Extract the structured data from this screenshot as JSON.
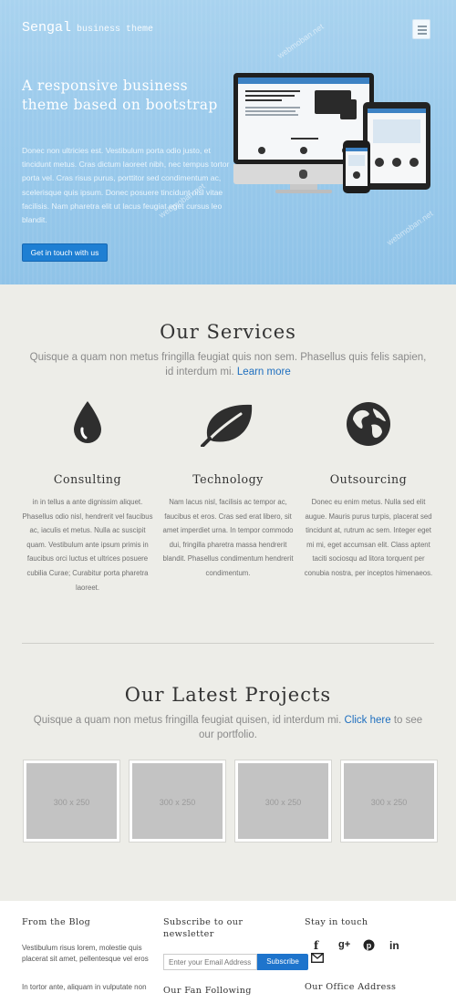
{
  "header": {
    "brand": "Sengal",
    "brand_tag": "business theme",
    "menu_icon": "hamburger-icon"
  },
  "hero": {
    "title": "A responsive business theme based on bootstrap",
    "text": "Donec non ultricies est. Vestibulum porta odio justo, et tincidunt metus. Cras dictum laoreet nibh, nec tempus tortor porta vel. Cras risus purus, porttitor sed condimentum ac, scelerisque quis ipsum. Donec posuere tincidunt nisl vitae facilisis. Nam pharetra elit ut lacus feugiat eget cursus leo blandit.",
    "cta": "Get in touch with us"
  },
  "services": {
    "title": "Our Services",
    "subtitle": "Quisque a quam non metus fringilla feugiat quis non sem. Phasellus quis felis sapien, id interdum mi.",
    "learn_more": "Learn more",
    "items": [
      {
        "name": "Consulting",
        "icon": "drop-icon",
        "desc": "in in tellus a ante dignissim aliquet. Phasellus odio nisl, hendrerit vel faucibus ac, iaculis et metus. Nulla ac suscipit quam. Vestibulum ante ipsum primis in faucibus orci luctus et ultrices posuere cubilia Curae; Curabitur porta pharetra laoreet."
      },
      {
        "name": "Technology",
        "icon": "leaf-icon",
        "desc": "Nam lacus nisl, facilisis ac tempor ac, faucibus et eros. Cras sed erat libero, sit amet imperdiet urna. In tempor commodo dui, fringilla pharetra massa hendrerit blandit. Phasellus condimentum hendrerit condimentum."
      },
      {
        "name": "Outsourcing",
        "icon": "globe-icon",
        "desc": "Donec eu enim metus. Nulla sed elit augue. Mauris purus turpis, placerat sed tincidunt at, rutrum ac sem. Integer eget mi mi, eget accumsan elit. Class aptent taciti sociosqu ad litora torquent per conubia nostra, per inceptos himenaeos."
      }
    ]
  },
  "projects": {
    "title": "Our Latest Projects",
    "subtitle": "Quisque a quam non metus fringilla feugiat quisen, id interdum mi.",
    "click_here": "Click here",
    "subtitle_tail": "to see our portfolio.",
    "thumbs": [
      "300 x 250",
      "300 x 250",
      "300 x 250",
      "300 x 250"
    ]
  },
  "footer": {
    "blog_title": "From the Blog",
    "blog_post_1": "Vestibulum risus lorem, molestie quis placerat sit amet, pellentesque vel eros",
    "blog_post_2": "In tortor ante, aliquam in vulputate non",
    "newsletter_title": "Subscribe to our newsletter",
    "email_placeholder": "Enter your Email Address",
    "subscribe": "Subscribe",
    "fan_title": "Our Fan Following",
    "touch_title": "Stay in touch",
    "social": [
      "f",
      "g+",
      "p",
      "in"
    ],
    "office_title": "Our Office Address"
  },
  "watermark": "webmoban.net"
}
